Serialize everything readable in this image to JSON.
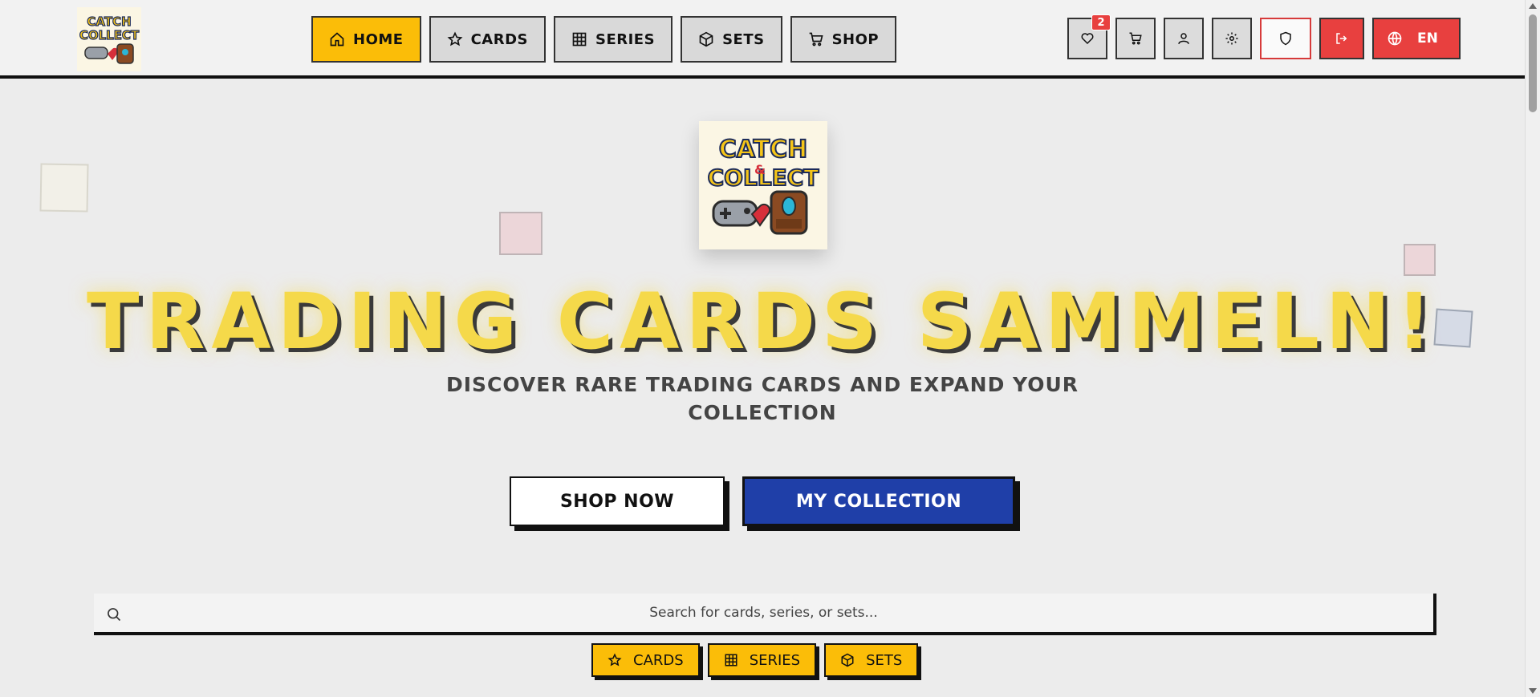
{
  "brand": {
    "logo_alt": "Catch & Collect",
    "logo_text_line1": "CATCH",
    "logo_text_line2": "COLLECT"
  },
  "nav": {
    "items": [
      {
        "label": "HOME",
        "icon": "home-icon",
        "active": true
      },
      {
        "label": "CARDS",
        "icon": "star-icon",
        "active": false
      },
      {
        "label": "SERIES",
        "icon": "grid-icon",
        "active": false
      },
      {
        "label": "SETS",
        "icon": "box-icon",
        "active": false
      },
      {
        "label": "SHOP",
        "icon": "cart-icon",
        "active": false
      }
    ]
  },
  "toolbar": {
    "favorites_count": "2",
    "language_label": "EN"
  },
  "hero": {
    "title": "TRADING CARDS SAMMELN!",
    "subtitle": "DISCOVER RARE TRADING CARDS AND EXPAND YOUR COLLECTION",
    "shop_button": "SHOP NOW",
    "collection_button": "MY COLLECTION"
  },
  "search": {
    "placeholder": "Search for cards, series, or sets..."
  },
  "quick_links": [
    {
      "label": "CARDS",
      "icon": "star-icon"
    },
    {
      "label": "SERIES",
      "icon": "grid-icon"
    },
    {
      "label": "SETS",
      "icon": "box-icon"
    }
  ],
  "colors": {
    "accent_yellow": "#fbbd08",
    "title_yellow": "#f5d94a",
    "primary_blue": "#1f3fa8",
    "danger_red": "#e8403f",
    "border_dark": "#111111"
  }
}
